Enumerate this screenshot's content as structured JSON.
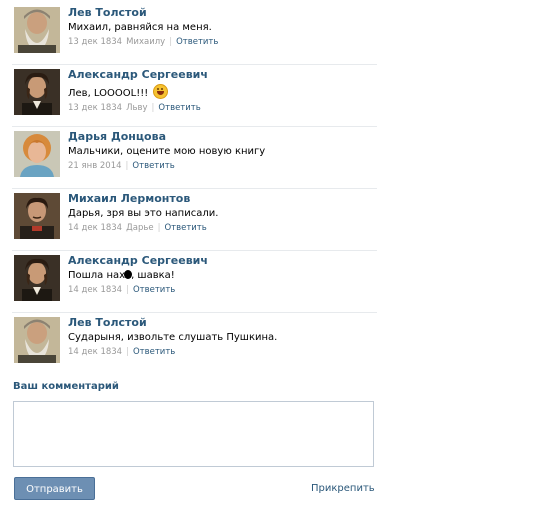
{
  "comments": [
    {
      "author": "Лев Толстой",
      "text": "Михаил, равняйся на меня.",
      "date": "13 дек 1834",
      "to": "Михаилу",
      "reply": "Ответить",
      "avatar": "tolstoy"
    },
    {
      "author": "Александр Сергеевич",
      "text": "Лев, LOOOOL!!!",
      "has_emoji": true,
      "emoji_icon": "laughing-smiley-icon",
      "date": "13 дек 1834",
      "to": "Льву",
      "reply": "Ответить",
      "avatar": "pushkin"
    },
    {
      "author": "Дарья Донцова",
      "text": "Мальчики, оцените мою новую книгу",
      "date": "21 янв 2014",
      "to": "",
      "reply": "Ответить",
      "avatar": "dontsova"
    },
    {
      "author": "Михаил Лермонтов",
      "text": "Дарья, зря вы это написали.",
      "date": "14 дек 1834",
      "to": "Дарье",
      "reply": "Ответить",
      "avatar": "lermontov"
    },
    {
      "author": "Александр Сергеевич",
      "text_before": "Пошла нах",
      "text_after": ", шавка!",
      "has_blot": true,
      "date": "14 дек 1834",
      "to": "",
      "reply": "Ответить",
      "avatar": "pushkin"
    },
    {
      "author": "Лев Толстой",
      "text": "Сударыня, извольте слушать Пушкина.",
      "date": "14 дек 1834",
      "to": "",
      "reply": "Ответить",
      "avatar": "tolstoy"
    }
  ],
  "form": {
    "title": "Ваш комментарий",
    "textarea_value": "",
    "send_label": "Отправить",
    "attach_label": "Прикрепить"
  },
  "colors": {
    "link": "#2b587a",
    "button": "#6d8fb3",
    "meta": "#999999"
  }
}
